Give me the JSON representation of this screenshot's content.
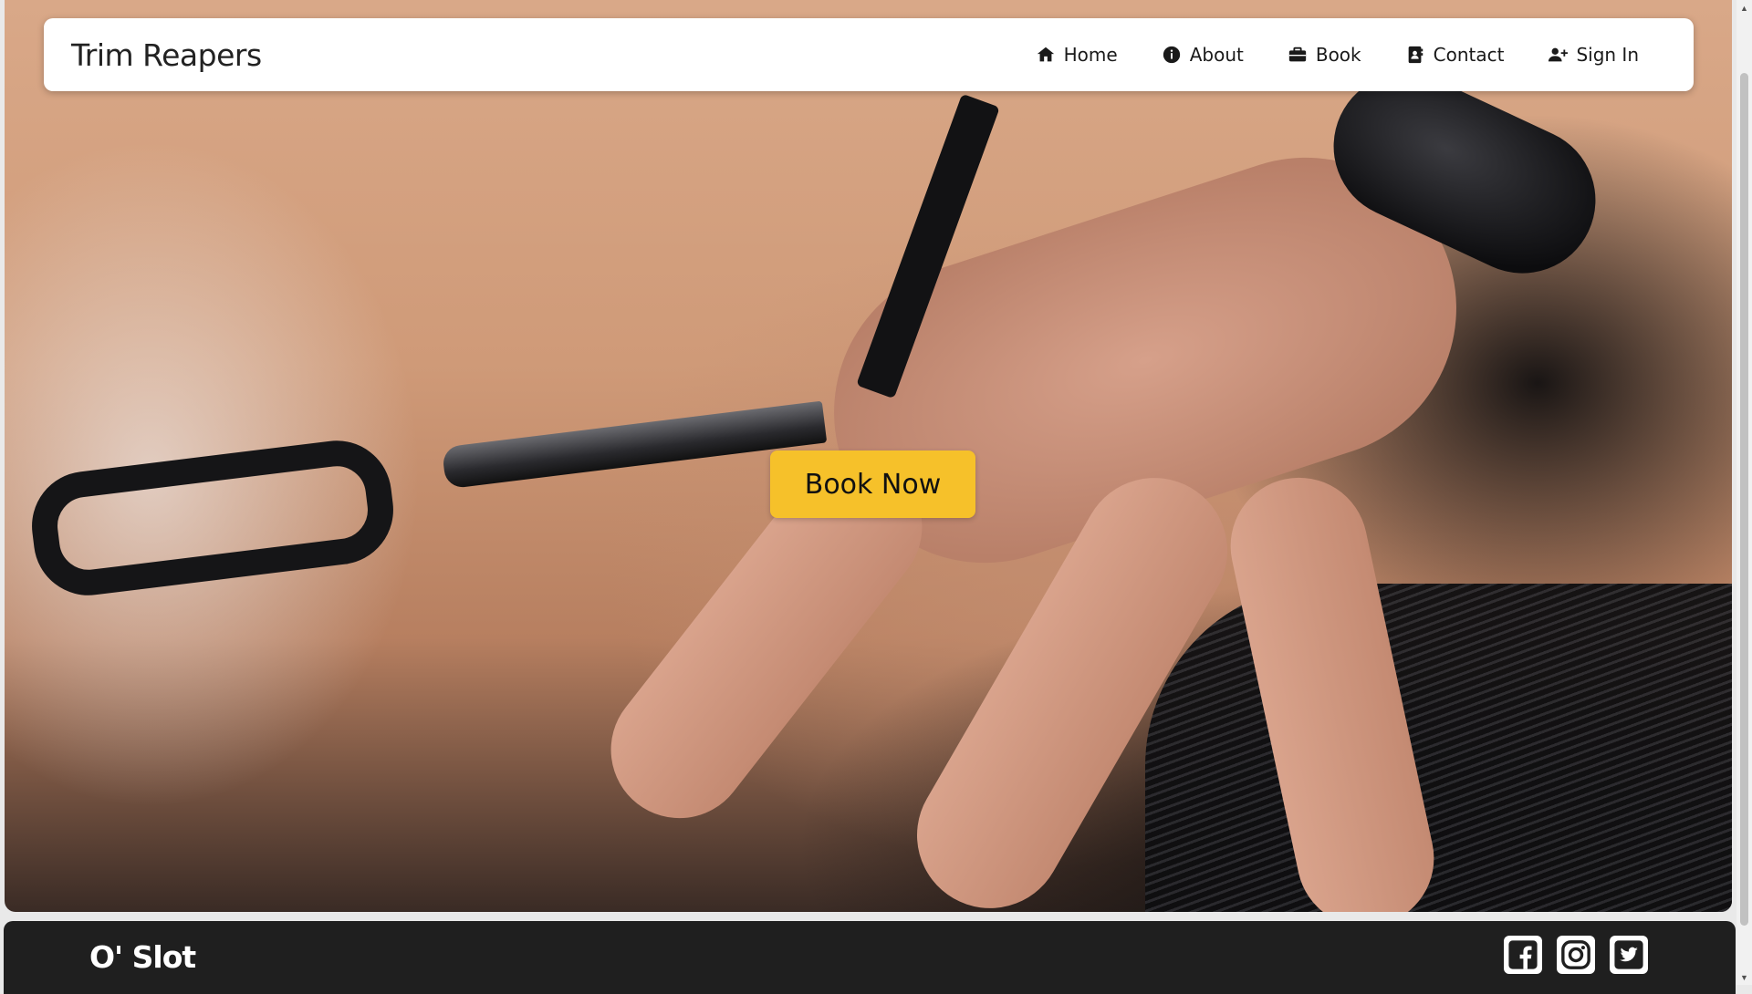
{
  "brand": "Trim Reapers",
  "nav": {
    "items": [
      {
        "label": "Home",
        "icon": "home-icon"
      },
      {
        "label": "About",
        "icon": "info-icon"
      },
      {
        "label": "Book",
        "icon": "briefcase-icon"
      },
      {
        "label": "Contact",
        "icon": "contact-book-icon"
      },
      {
        "label": "Sign In",
        "icon": "user-plus-icon"
      }
    ]
  },
  "hero": {
    "cta_label": "Book Now",
    "cta_color": "#f6c12a"
  },
  "footer": {
    "brand": "O' Slot",
    "socials": [
      "facebook-icon",
      "instagram-icon",
      "twitter-icon"
    ],
    "background": "#1f1f1f"
  }
}
